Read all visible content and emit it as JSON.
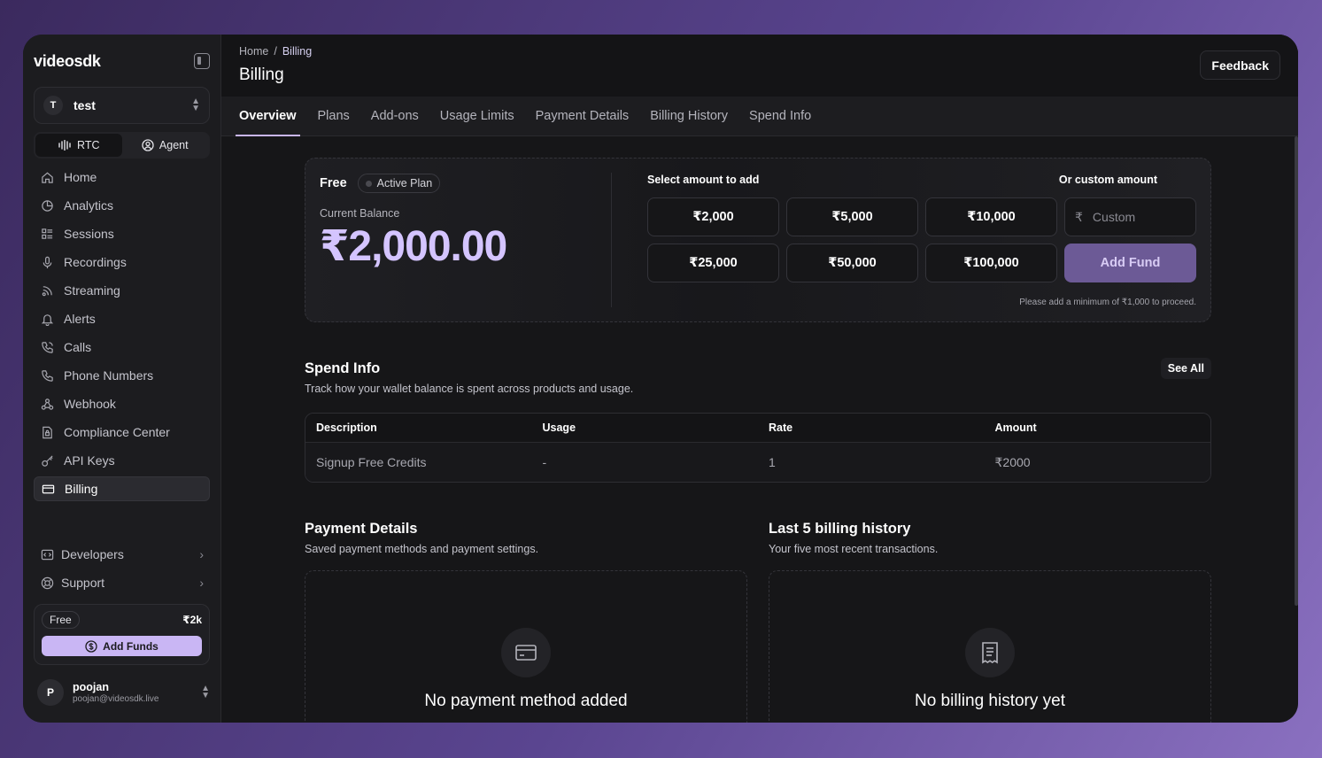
{
  "brand": "videosdk",
  "workspace": {
    "initial": "T",
    "name": "test"
  },
  "modes": {
    "rtc": "RTC",
    "agent": "Agent"
  },
  "nav": [
    {
      "label": "Home",
      "icon": "home-icon"
    },
    {
      "label": "Analytics",
      "icon": "clock-chart-icon"
    },
    {
      "label": "Sessions",
      "icon": "list-icon"
    },
    {
      "label": "Recordings",
      "icon": "mic-icon"
    },
    {
      "label": "Streaming",
      "icon": "broadcast-icon"
    },
    {
      "label": "Alerts",
      "icon": "bell-icon"
    },
    {
      "label": "Calls",
      "icon": "phone-call-icon"
    },
    {
      "label": "Phone Numbers",
      "icon": "phone-icon"
    },
    {
      "label": "Webhook",
      "icon": "webhook-icon"
    },
    {
      "label": "Compliance Center",
      "icon": "document-lock-icon"
    },
    {
      "label": "API Keys",
      "icon": "key-icon"
    },
    {
      "label": "Billing",
      "icon": "card-icon"
    }
  ],
  "nav_secondary": [
    {
      "label": "Developers",
      "icon": "code-icon"
    },
    {
      "label": "Support",
      "icon": "lifebuoy-icon"
    }
  ],
  "sidebar_plan": {
    "plan": "Free",
    "amount": "₹2k",
    "add_funds": "Add Funds"
  },
  "user": {
    "initial": "P",
    "name": "poojan",
    "email": "poojan@videosdk.live"
  },
  "header": {
    "breadcrumb_home": "Home",
    "breadcrumb_sep": "/",
    "breadcrumb_current": "Billing",
    "title": "Billing",
    "feedback": "Feedback"
  },
  "tabs": [
    "Overview",
    "Plans",
    "Add-ons",
    "Usage Limits",
    "Payment Details",
    "Billing History",
    "Spend Info"
  ],
  "balance": {
    "plan": "Free",
    "plan_badge": "Active Plan",
    "label": "Current Balance",
    "amount": "₹2,000.00",
    "select_label": "Select amount to add",
    "custom_label": "Or custom amount",
    "amounts": [
      "₹2,000",
      "₹5,000",
      "₹10,000",
      "₹25,000",
      "₹50,000",
      "₹100,000"
    ],
    "currency_symbol": "₹",
    "custom_placeholder": "Custom",
    "add_fund": "Add Fund",
    "min_note": "Please add a minimum of ₹1,000 to proceed."
  },
  "spend": {
    "title": "Spend Info",
    "subtitle": "Track how your wallet balance is spent across products and usage.",
    "see_all": "See All",
    "columns": [
      "Description",
      "Usage",
      "Rate",
      "Amount"
    ],
    "rows": [
      [
        "Signup Free Credits",
        "-",
        "1",
        "₹2000"
      ]
    ]
  },
  "payment": {
    "title": "Payment Details",
    "subtitle": "Saved payment methods and payment settings.",
    "empty": "No payment method added"
  },
  "history": {
    "title": "Last 5 billing history",
    "subtitle": "Your five most recent transactions.",
    "empty": "No billing history yet"
  },
  "colors": {
    "accent": "#c9b6f4",
    "balance": "#d4c4ff",
    "add_fund_bg": "#6c5a96"
  }
}
